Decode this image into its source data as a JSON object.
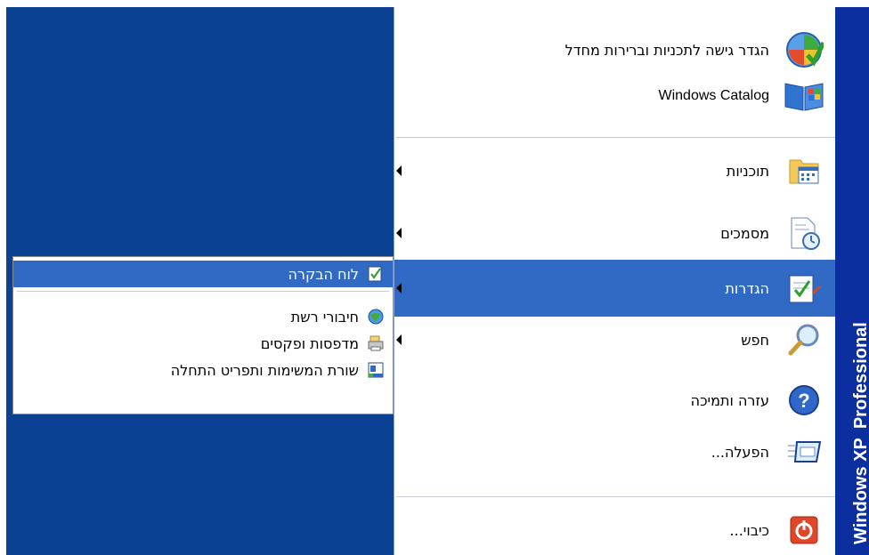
{
  "window": {
    "band_text": "Windows XP",
    "band_text_edition": "Professional"
  },
  "menu": {
    "items": [
      {
        "label": "הגדר גישה לתכניות וברירות מחדל",
        "icon": "set-program-access-icon",
        "has_submenu": false
      },
      {
        "label": "Windows Catalog",
        "icon": "windows-catalog-icon",
        "has_submenu": false
      },
      {
        "label": "תוכניות",
        "icon": "programs-folder-icon",
        "has_submenu": true
      },
      {
        "label": "מסמכים",
        "icon": "documents-icon",
        "has_submenu": true
      },
      {
        "label": "הגדרות",
        "icon": "settings-icon",
        "has_submenu": true,
        "selected": true
      },
      {
        "label": "חפש",
        "icon": "search-magnifier-icon",
        "has_submenu": true
      },
      {
        "label": "עזרה ותמיכה",
        "icon": "help-icon",
        "has_submenu": false
      },
      {
        "label": "הפעלה...",
        "icon": "run-icon",
        "has_submenu": false
      },
      {
        "label": "כיבוי...",
        "icon": "shutdown-icon",
        "has_submenu": false
      }
    ]
  },
  "submenu": {
    "items": [
      {
        "label": "לוח הבקרה",
        "icon": "control-panel-icon",
        "selected": true
      },
      {
        "label": "חיבורי רשת",
        "icon": "network-connections-icon"
      },
      {
        "label": "מדפסות ופקסים",
        "icon": "printers-faxes-icon"
      },
      {
        "label": "שורת המשימות ותפריט התחלה",
        "icon": "taskbar-start-menu-icon"
      }
    ]
  },
  "colors": {
    "desktop": "#0a4193",
    "band": "#0c2f9f",
    "highlight": "#316ac5"
  }
}
